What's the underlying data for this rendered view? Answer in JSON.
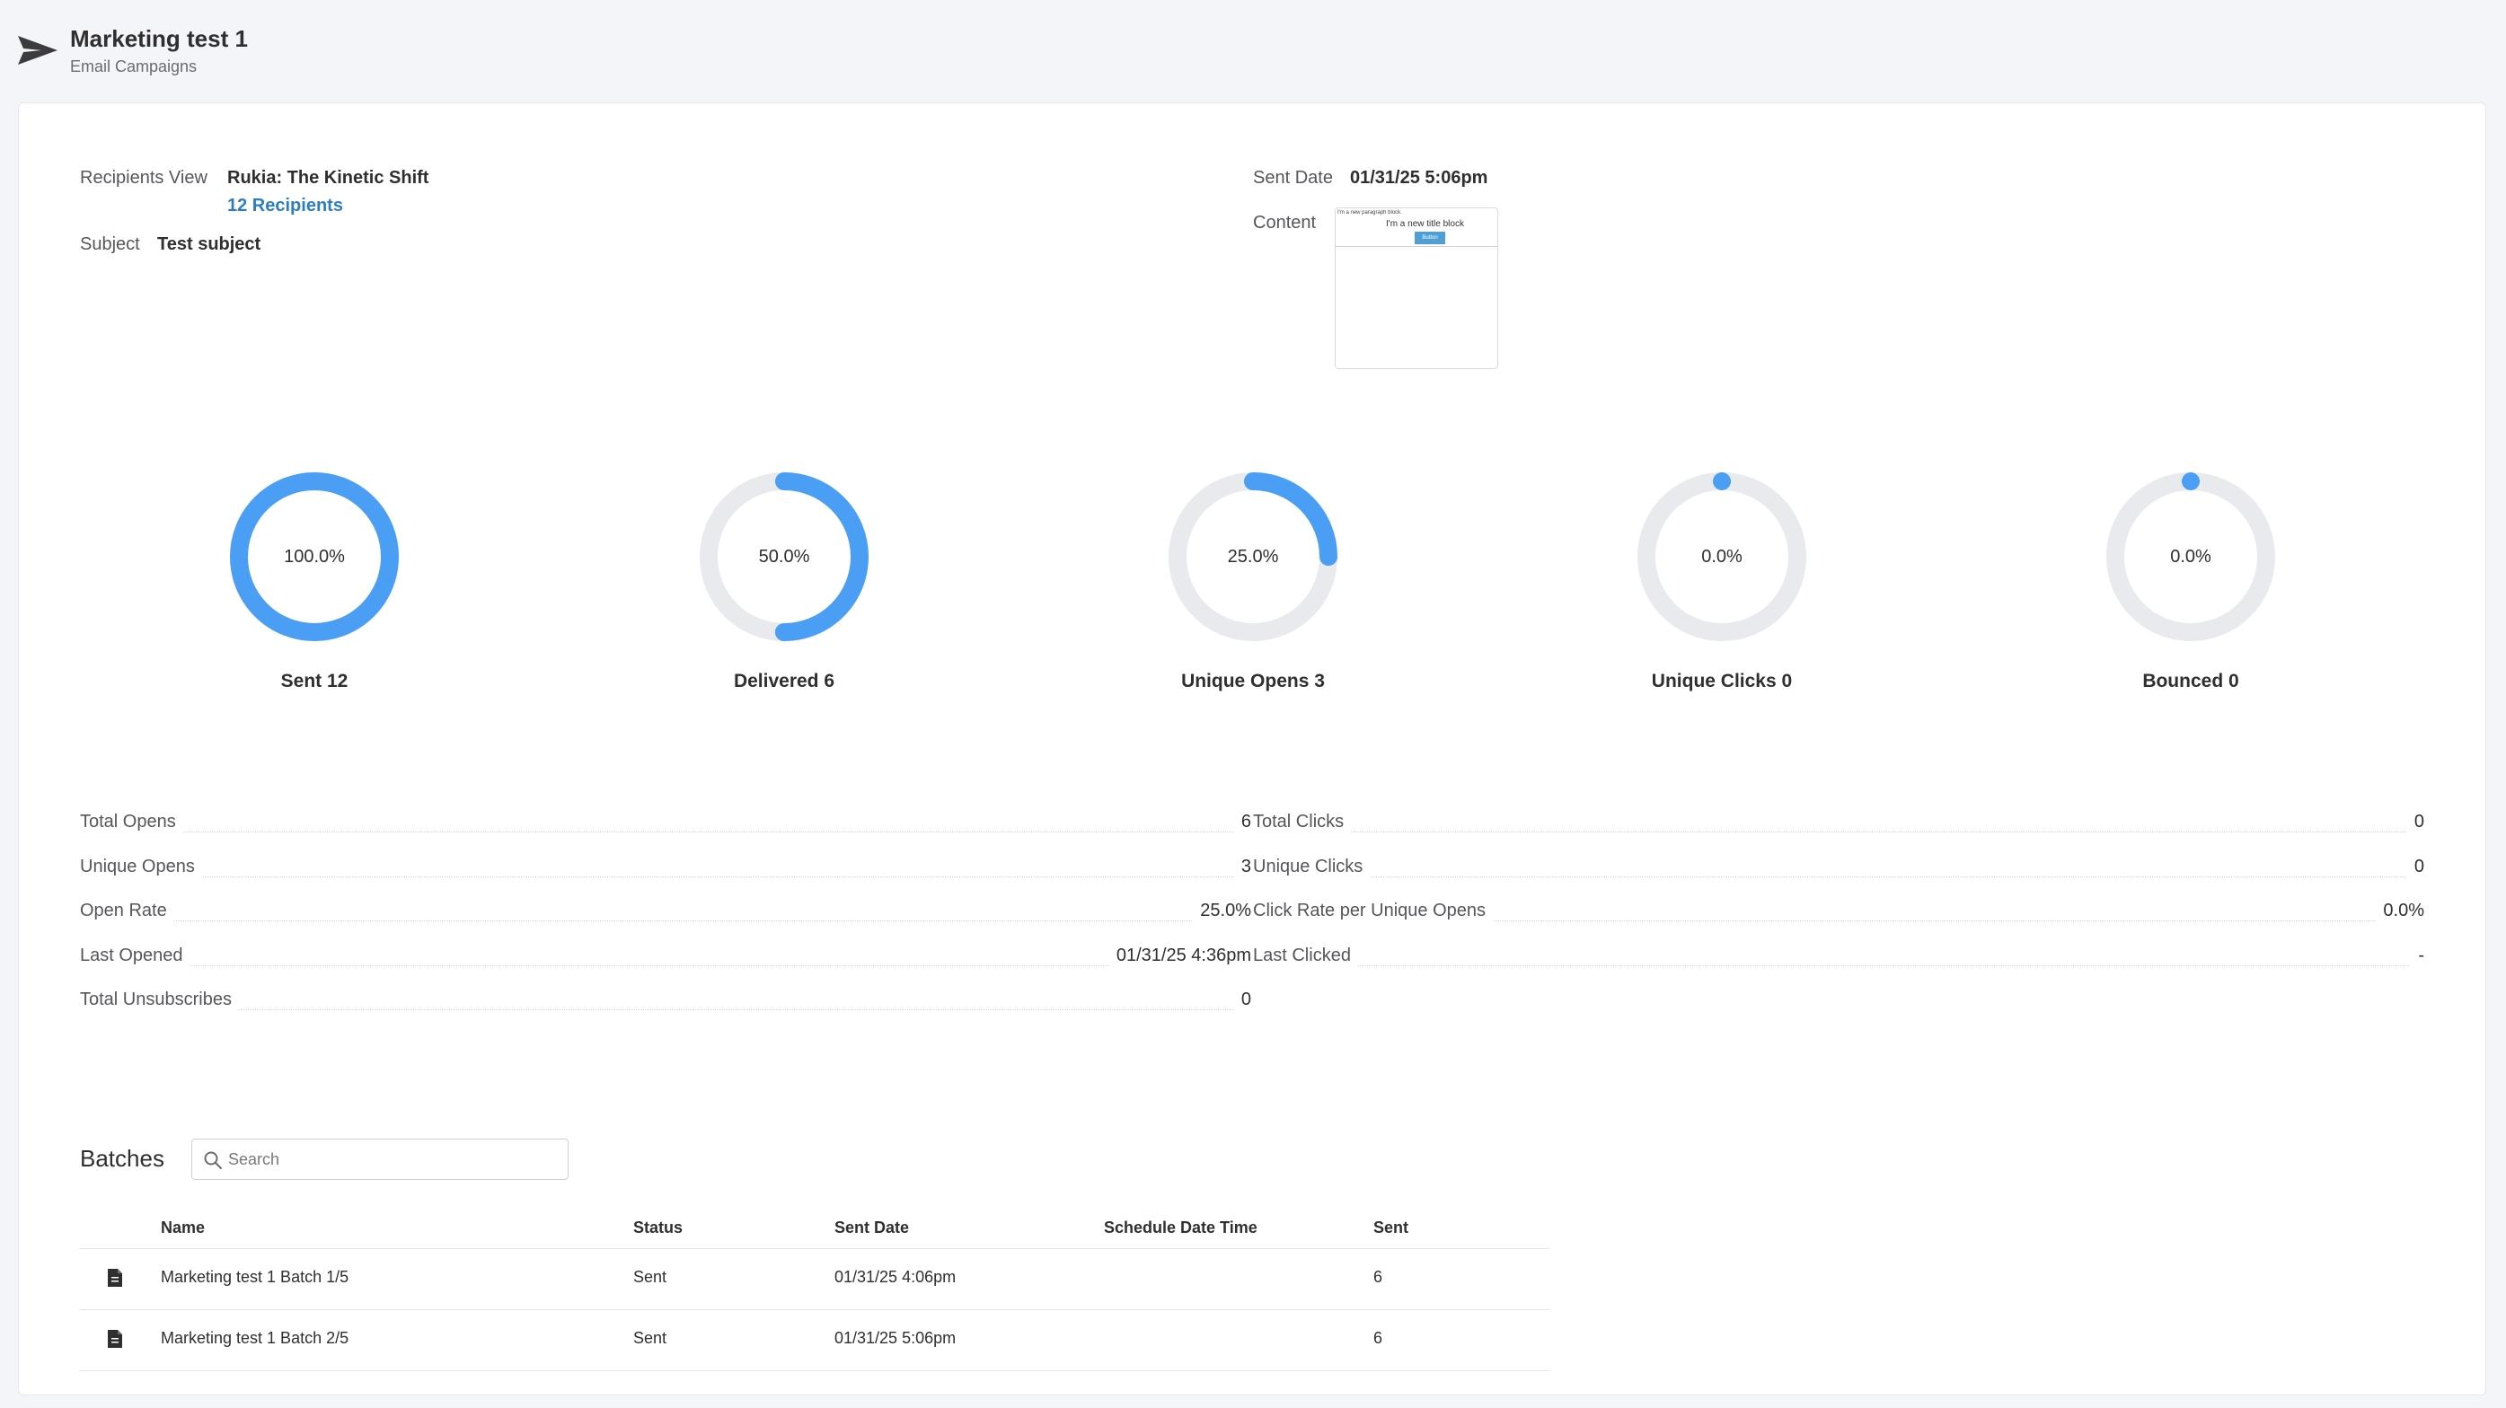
{
  "header": {
    "icon": "paper-plane-icon",
    "title": "Marketing test 1",
    "subtitle": "Email Campaigns"
  },
  "details": {
    "recipients_view_label": "Recipients View",
    "recipients_view_value": "Rukia: The Kinetic Shift",
    "recipients_link": "12 Recipients",
    "subject_label": "Subject",
    "subject_value": "Test subject",
    "sent_date_label": "Sent Date",
    "sent_date_value": "01/31/25 5:06pm",
    "content_label": "Content",
    "content_preview": {
      "paragraph": "I'm a new paragraph block.",
      "title": "I'm a new title block",
      "button": "Button"
    }
  },
  "donuts": [
    {
      "label": "Sent 12",
      "percent_text": "100.0%",
      "percent": 100.0
    },
    {
      "label": "Delivered 6",
      "percent_text": "50.0%",
      "percent": 50.0
    },
    {
      "label": "Unique Opens 3",
      "percent_text": "25.0%",
      "percent": 25.0
    },
    {
      "label": "Unique Clicks 0",
      "percent_text": "0.0%",
      "percent": 0.0
    },
    {
      "label": "Bounced 0",
      "percent_text": "0.0%",
      "percent": 0.0
    }
  ],
  "colors": {
    "accent": "#4a9ff5",
    "track": "#e9eaee",
    "link": "#2d7ec1"
  },
  "stats_left": [
    {
      "label": "Total Opens",
      "value": "6"
    },
    {
      "label": "Unique Opens",
      "value": "3"
    },
    {
      "label": "Open Rate",
      "value": "25.0%"
    },
    {
      "label": "Last Opened",
      "value": "01/31/25 4:36pm"
    },
    {
      "label": "Total Unsubscribes",
      "value": "0"
    }
  ],
  "stats_right": [
    {
      "label": "Total Clicks",
      "value": "0"
    },
    {
      "label": "Unique Clicks",
      "value": "0"
    },
    {
      "label": "Click Rate per Unique Opens",
      "value": "0.0%"
    },
    {
      "label": "Last Clicked",
      "value": "-"
    }
  ],
  "batches": {
    "title": "Batches",
    "search_placeholder": "Search",
    "columns": [
      "Name",
      "Status",
      "Sent Date",
      "Schedule Date Time",
      "Sent"
    ],
    "rows": [
      {
        "icon": "file-icon",
        "name": "Marketing test 1 Batch 1/5",
        "status": "Sent",
        "sent_date": "01/31/25 4:06pm",
        "schedule": "",
        "sent": "6"
      },
      {
        "icon": "file-icon",
        "name": "Marketing test 1 Batch 2/5",
        "status": "Sent",
        "sent_date": "01/31/25 5:06pm",
        "schedule": "",
        "sent": "6"
      }
    ]
  }
}
